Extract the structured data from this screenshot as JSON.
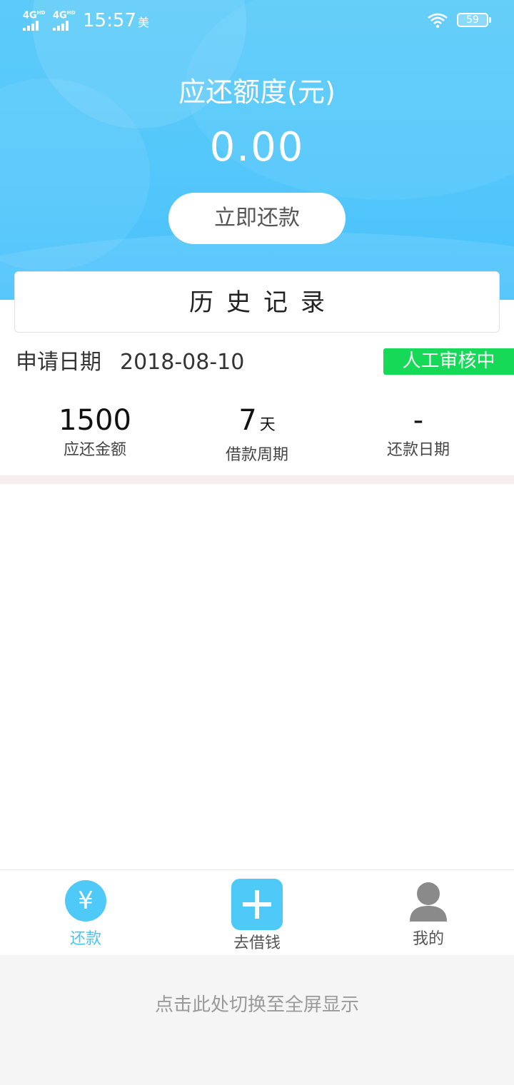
{
  "status_bar": {
    "network1": "4G",
    "network1_sup": "HD",
    "network2": "4G",
    "network2_sup": "HD",
    "time": "15:57",
    "carrier_glyph": "美",
    "battery": "59"
  },
  "header": {
    "quota_label": "应还额度(元)",
    "quota_value": "0.00",
    "repay_button": "立即还款"
  },
  "history": {
    "title": "历史记录",
    "apply_label": "申请日期",
    "apply_date": "2018-08-10",
    "status": "人工审核中",
    "stats": [
      {
        "value": "1500",
        "unit": "",
        "label": "应还金额"
      },
      {
        "value": "7",
        "unit": "天",
        "label": "借款周期"
      },
      {
        "value": "-",
        "unit": "",
        "label": "还款日期"
      }
    ]
  },
  "tabbar": {
    "tabs": [
      {
        "label": "还款",
        "icon": "yen-icon",
        "active": true
      },
      {
        "label": "去借钱",
        "icon": "plus-icon",
        "active": false
      },
      {
        "label": "我的",
        "icon": "person-icon",
        "active": false
      }
    ],
    "yen_glyph": "¥"
  },
  "fullscreen_hint": "点击此处切换至全屏显示",
  "colors": {
    "primary": "#4fc9f8",
    "status_green": "#16d957",
    "header_bg": "#53c7fb"
  }
}
